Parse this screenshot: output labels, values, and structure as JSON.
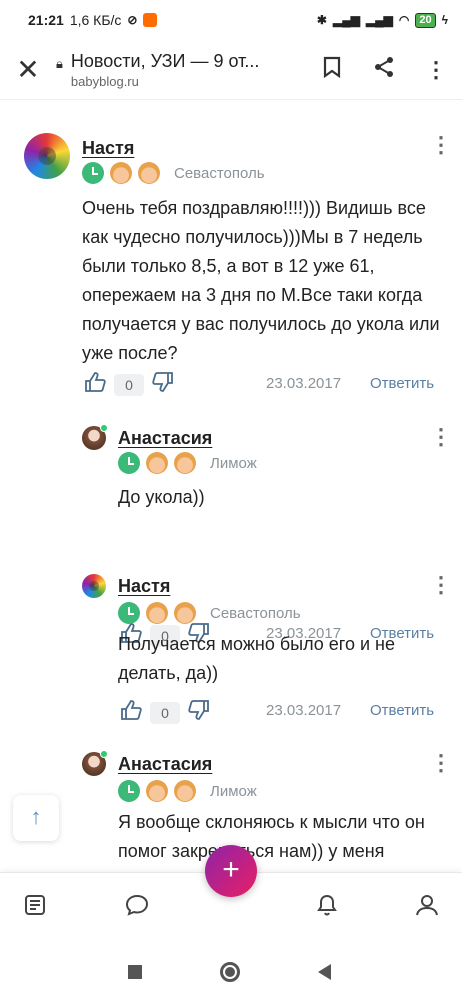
{
  "status_bar": {
    "time": "21:21",
    "speed": "1,6 КБ/с",
    "battery": "20"
  },
  "browser": {
    "title": "Новости, УЗИ — 9 от...",
    "url": "babyblog.ru",
    "close_icon": "close-icon",
    "bookmark_icon": "bookmark-icon",
    "share_icon": "share-icon",
    "menu_icon": "more-vert-icon"
  },
  "comments": [
    {
      "author": "Настя",
      "city": "Севастополь",
      "text": "Очень тебя поздравляю!!!!))) Видишь все как чудесно получилось)))Мы в 7 недель были только 8,5, а вот в 12 уже 61, опережаем на 3 дня по М.Все таки когда получается у вас получилось до укола или уже после?",
      "likes": "0",
      "date": "23.03.2017",
      "reply": "Ответить"
    },
    {
      "author": "Анастасия",
      "city": "Лимож",
      "text": "До укола))",
      "likes": "0",
      "date": "23.03.2017",
      "reply": "Ответить"
    },
    {
      "author": "Настя",
      "city": "Севастополь",
      "text": "Получается можно было его и не делать, да))",
      "likes": "0",
      "date": "23.03.2017",
      "reply": "Ответить"
    },
    {
      "author": "Анастасия",
      "city": "Лимож",
      "text": "Я вообще склоняюсь к мысли что он помог закрепиться нам)) у меня"
    }
  ],
  "bottom_nav": {
    "items": [
      "feed-icon",
      "chat-icon",
      "add-icon",
      "notifications-icon",
      "community-icon"
    ],
    "fab_label": "+"
  },
  "scroll_top_label": "↑"
}
